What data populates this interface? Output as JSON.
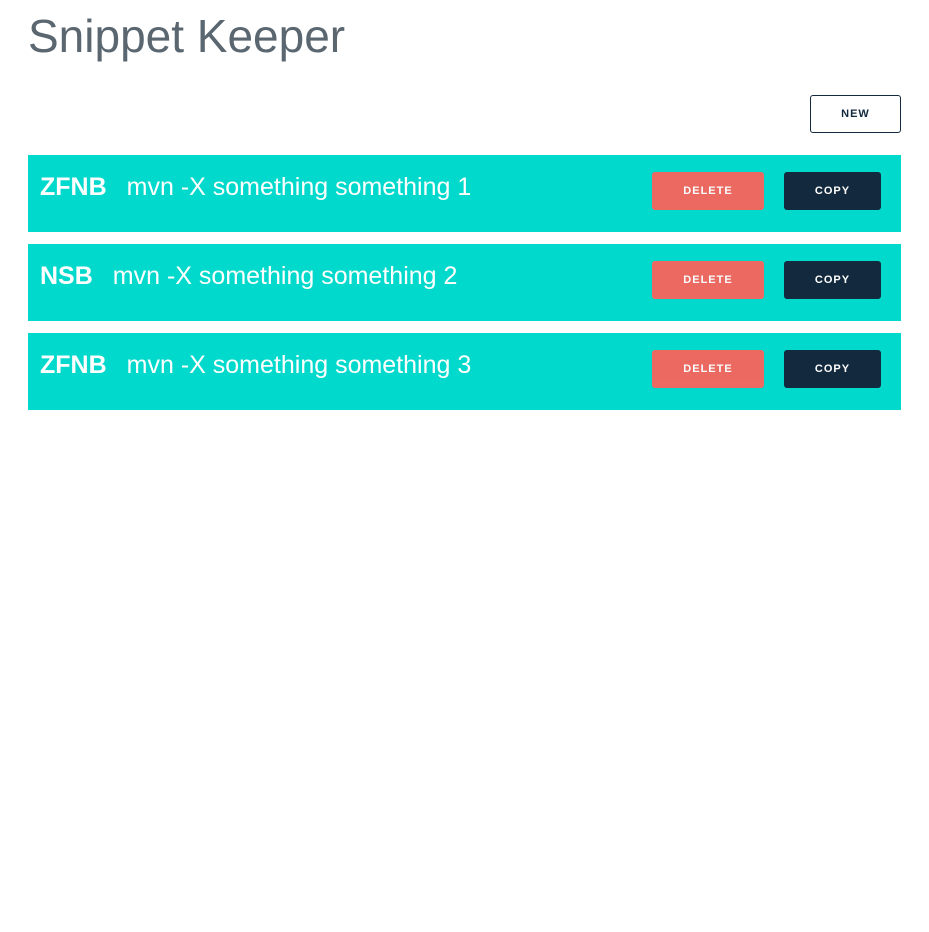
{
  "header": {
    "title": "Snippet Keeper"
  },
  "toolbar": {
    "new_label": "NEW"
  },
  "snippets": [
    {
      "tag": "ZFNB",
      "command": "mvn -X something something 1",
      "delete_label": "DELETE",
      "copy_label": "COPY"
    },
    {
      "tag": "NSB",
      "command": "mvn -X something something 2",
      "delete_label": "DELETE",
      "copy_label": "COPY"
    },
    {
      "tag": "ZFNB",
      "command": "mvn -X something something 3",
      "delete_label": "DELETE",
      "copy_label": "COPY"
    }
  ],
  "colors": {
    "row_background": "#00d9cb",
    "delete_button": "#f4665e",
    "copy_button": "#13293d",
    "title_text": "#5a6670"
  }
}
